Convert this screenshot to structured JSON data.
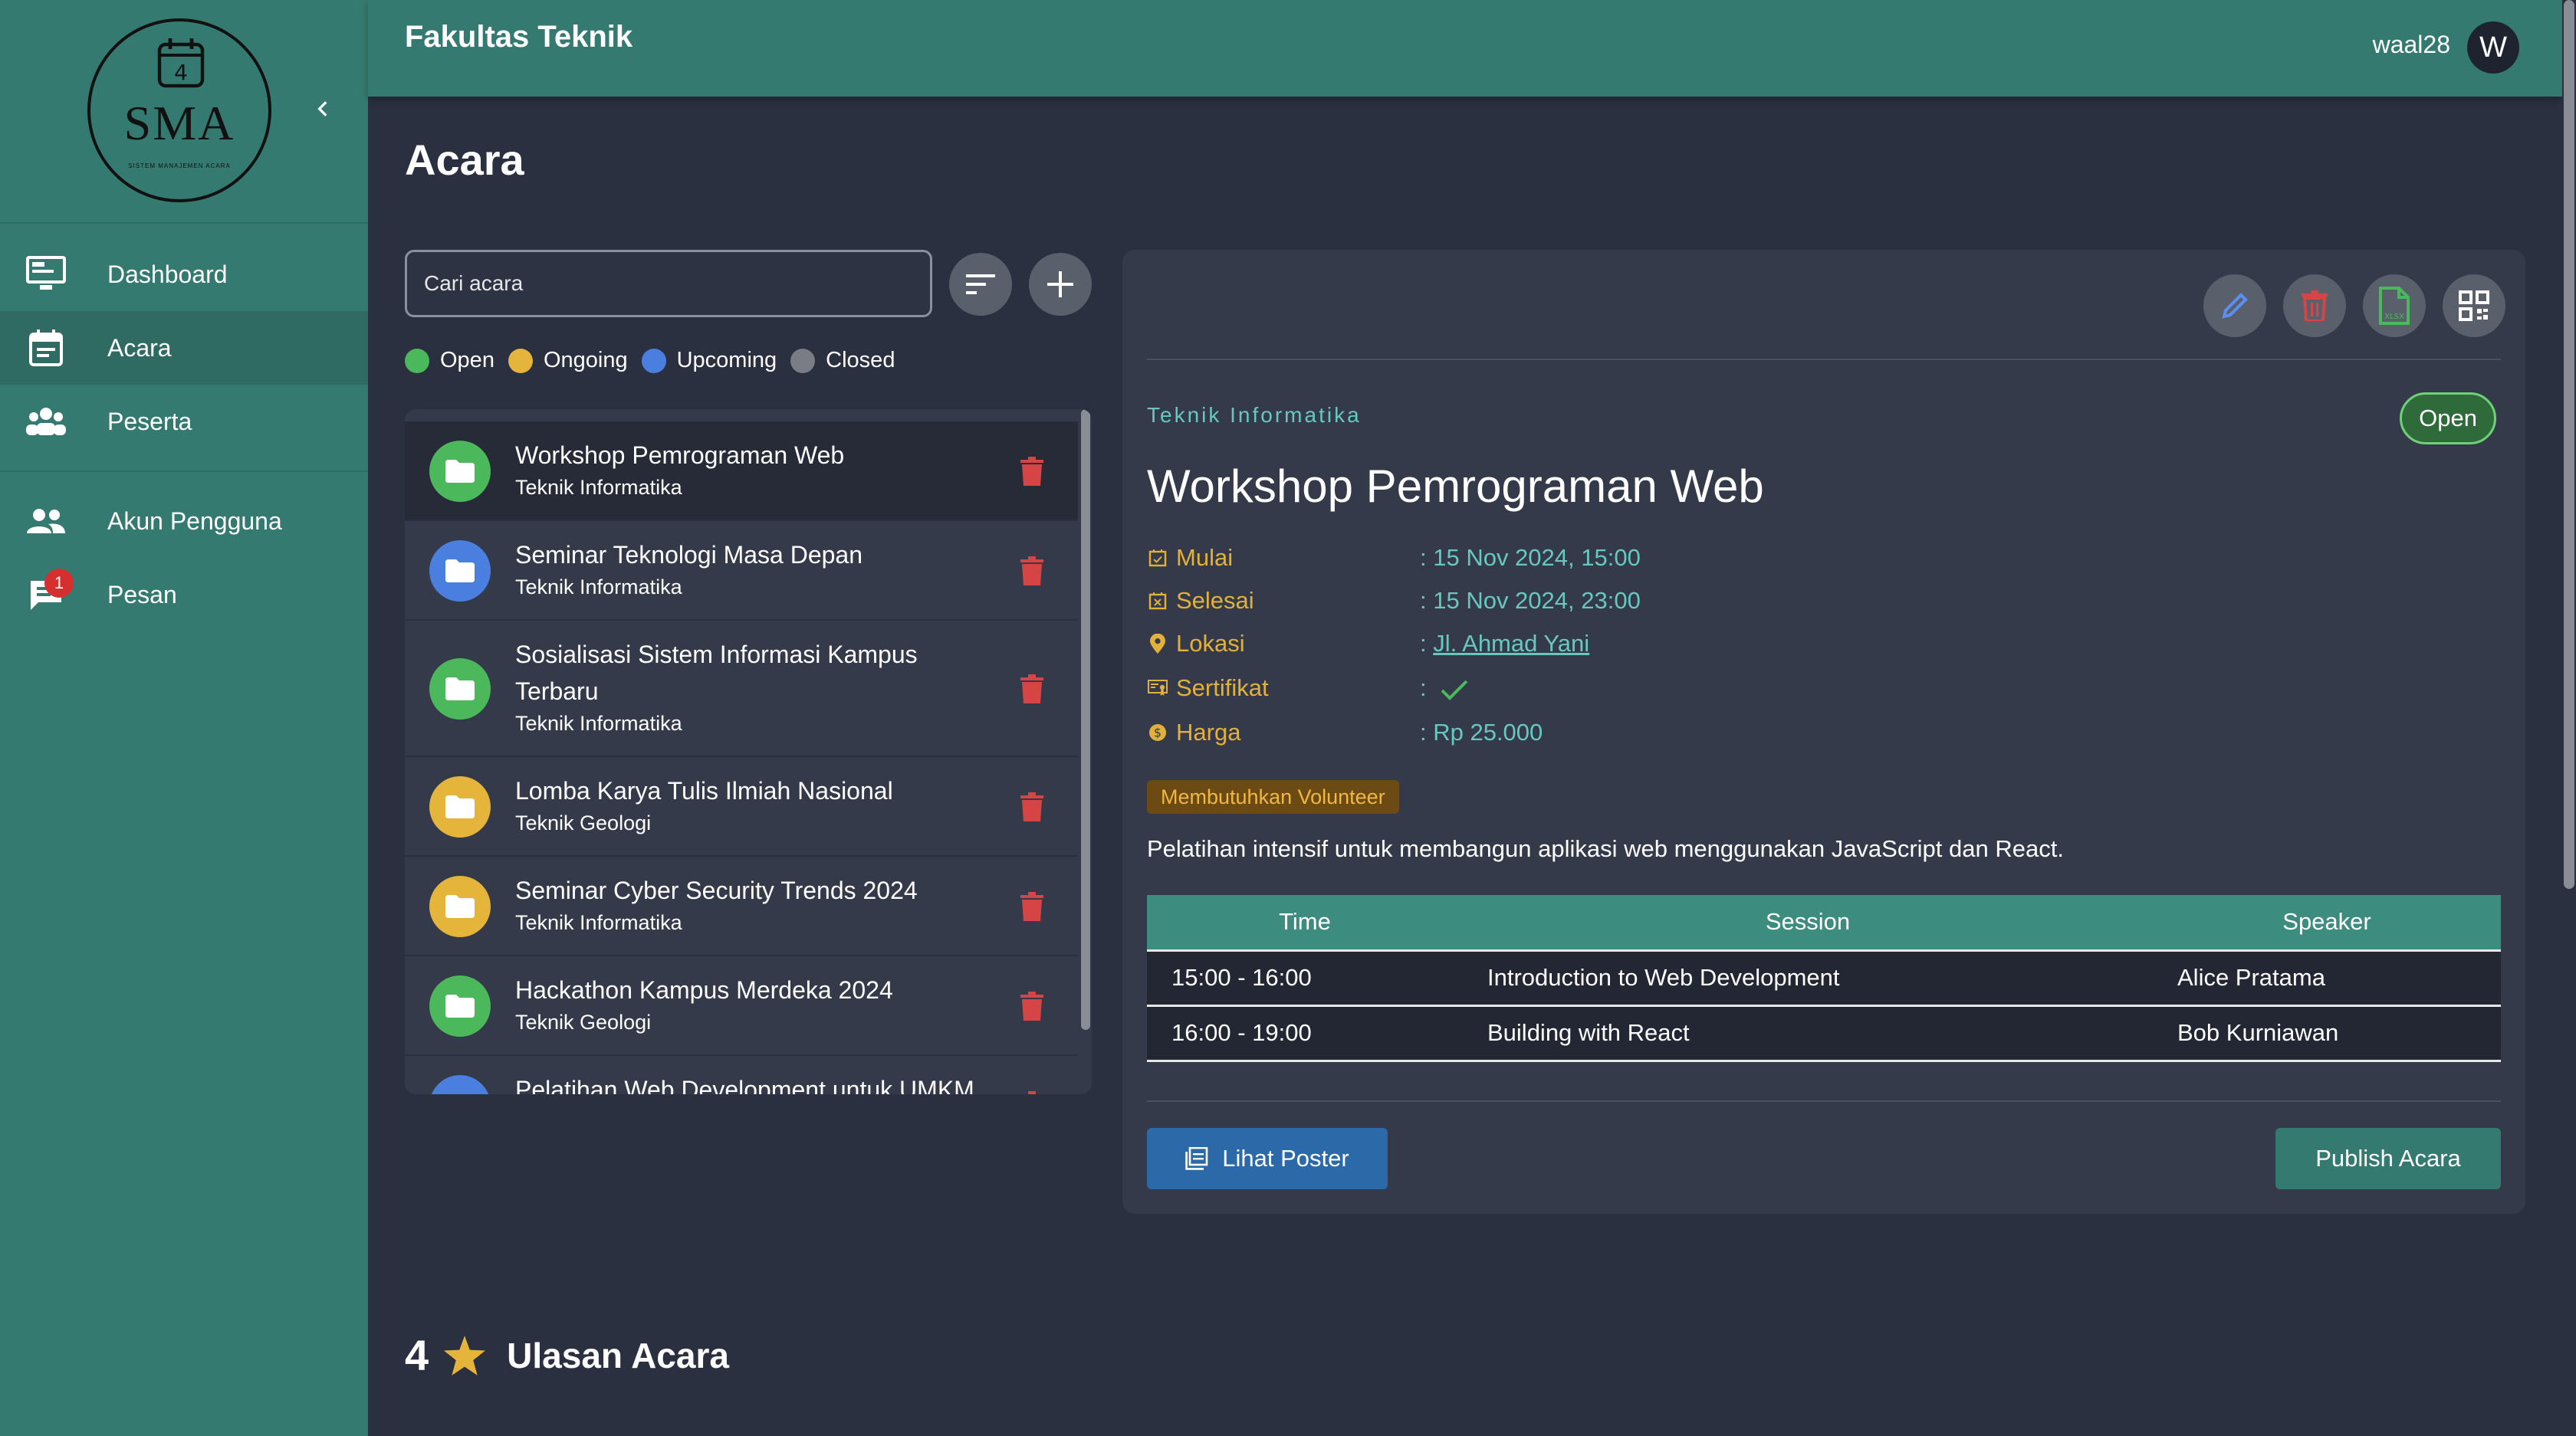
{
  "topbar": {
    "title": "Fakultas Teknik",
    "username": "waal28",
    "avatar_initial": "W"
  },
  "logo": {
    "text": "SMA",
    "subtitle": "SISTEM MANAJEMEN ACARA"
  },
  "sidebar": {
    "items": [
      {
        "label": "Dashboard",
        "icon": "monitor-icon"
      },
      {
        "label": "Acara",
        "icon": "calendar-icon",
        "active": true
      },
      {
        "label": "Peserta",
        "icon": "group-icon"
      },
      {
        "label": "Akun Pengguna",
        "icon": "users-icon"
      },
      {
        "label": "Pesan",
        "icon": "message-icon",
        "badge": "1"
      }
    ]
  },
  "page": {
    "title": "Acara"
  },
  "search": {
    "placeholder": "Cari acara"
  },
  "legend": [
    {
      "label": "Open",
      "color": "#4cb85c"
    },
    {
      "label": "Ongoing",
      "color": "#e5b53b"
    },
    {
      "label": "Upcoming",
      "color": "#4a7fe0"
    },
    {
      "label": "Closed",
      "color": "#7a7d86"
    }
  ],
  "events": [
    {
      "name": "Workshop Pemrograman Web",
      "dept": "Teknik Informatika",
      "status": "Open"
    },
    {
      "name": "Seminar Teknologi Masa Depan",
      "dept": "Teknik Informatika",
      "status": "Upcoming"
    },
    {
      "name": "Sosialisasi Sistem Informasi Kampus Terbaru",
      "dept": "Teknik Informatika",
      "status": "Open"
    },
    {
      "name": "Lomba Karya Tulis Ilmiah Nasional",
      "dept": "Teknik Geologi",
      "status": "Ongoing"
    },
    {
      "name": "Seminar Cyber Security Trends 2024",
      "dept": "Teknik Informatika",
      "status": "Ongoing"
    },
    {
      "name": "Hackathon Kampus Merdeka 2024",
      "dept": "Teknik Geologi",
      "status": "Open"
    },
    {
      "name": "Pelatihan Web Development untuk UMKM",
      "dept": "",
      "status": "Upcoming"
    }
  ],
  "detail": {
    "department": "Teknik Informatika",
    "status": "Open",
    "title": "Workshop Pemrograman Web",
    "info": {
      "start_label": "Mulai",
      "start_value": ": 15 Nov 2024, 15:00",
      "end_label": "Selesai",
      "end_value": ": 15 Nov 2024, 23:00",
      "location_label": "Lokasi",
      "location_prefix": ": ",
      "location_value": "Jl. Ahmad Yani",
      "certificate_label": "Sertifikat",
      "certificate_prefix": ":",
      "price_label": "Harga",
      "price_value": ": Rp 25.000"
    },
    "volunteer_tag": "Membutuhkan Volunteer",
    "description": "Pelatihan intensif untuk membangun aplikasi web menggunakan JavaScript dan React.",
    "schedule": {
      "headers": {
        "time": "Time",
        "session": "Session",
        "speaker": "Speaker"
      },
      "rows": [
        {
          "time": "15:00 - 16:00",
          "session": "Introduction to Web Development",
          "speaker": "Alice Pratama"
        },
        {
          "time": "16:00 - 19:00",
          "session": "Building with React",
          "speaker": "Bob Kurniawan"
        }
      ]
    },
    "poster_button": "Lihat Poster",
    "publish_button": "Publish Acara"
  },
  "review": {
    "score": "4",
    "title": "Ulasan Acara"
  },
  "colors": {
    "primary": "#357a70",
    "background": "#2b3040",
    "panel": "#353a4a",
    "accent_text": "#68c8c0",
    "label_gold": "#e2b13a",
    "danger": "#d64545"
  }
}
